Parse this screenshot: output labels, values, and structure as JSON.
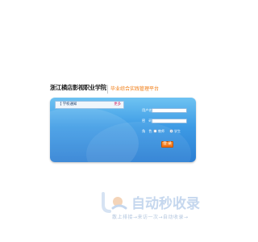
{
  "header": {
    "school_name": "浙江横店影视职业学院",
    "platform_name": "毕业综合实践管理平台"
  },
  "notice": {
    "title": "【 学校通知",
    "more": "更多"
  },
  "login": {
    "username_label": "用户名",
    "password_label": "密　码",
    "role_label": "角　色",
    "role_options": [
      "教师",
      "学生"
    ],
    "selected_role": "学生",
    "login_button": "登 录"
  },
  "watermark": {
    "title": "自动秒收录",
    "subtitle": "散上排接→来访一次→自动收录→"
  },
  "colors": {
    "panel_top": "#6fc3f2",
    "panel_bottom": "#2b7ed3",
    "accent_orange": "#f07a10",
    "watermark": "#c5d7ee"
  }
}
